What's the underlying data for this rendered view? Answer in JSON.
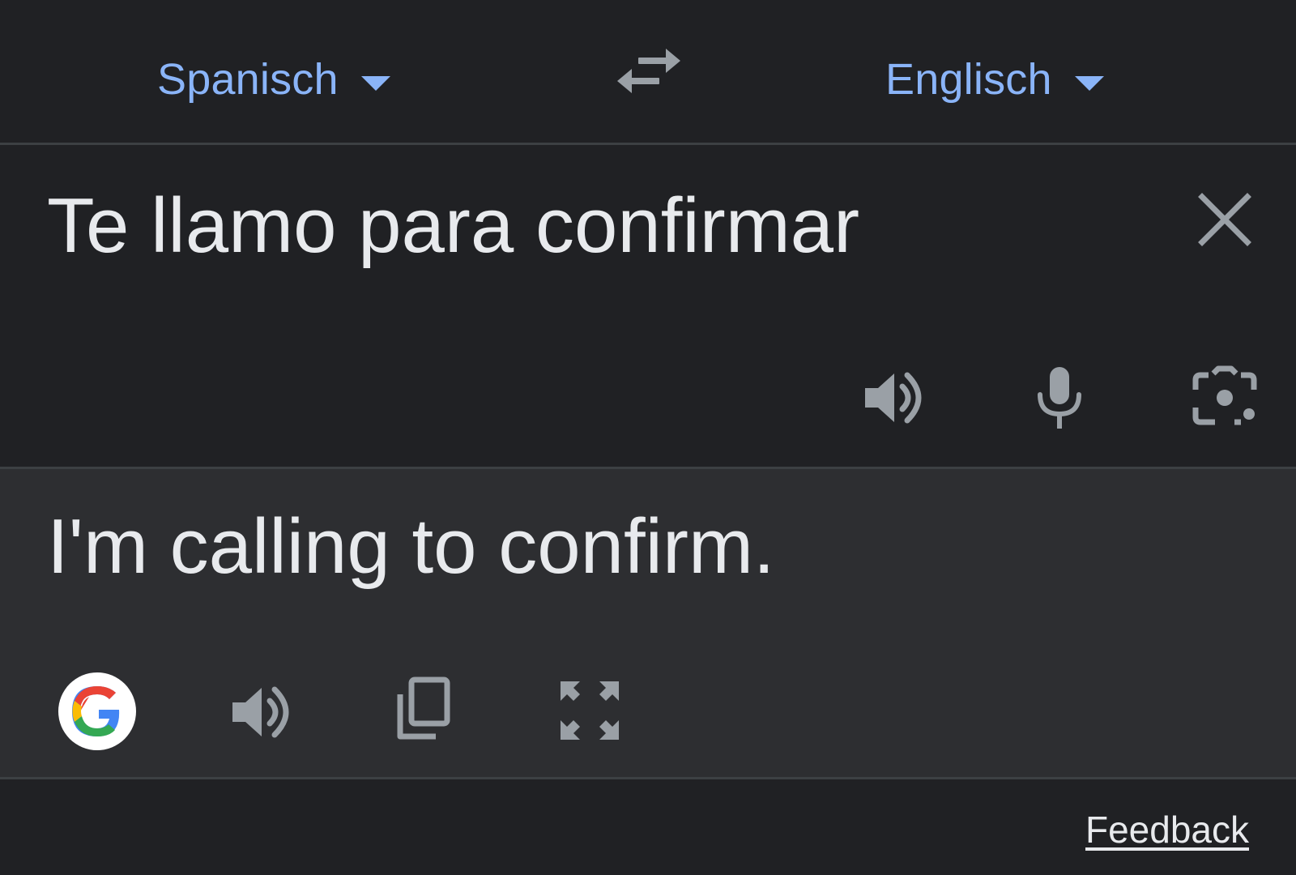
{
  "header": {
    "source_language": "Spanisch",
    "target_language": "Englisch",
    "swap_icon": "swap-arrows-icon",
    "dropdown_icon": "caret-down-icon"
  },
  "source": {
    "text": "Te llamo para confirmar",
    "actions": [
      "speaker-icon",
      "microphone-icon",
      "camera-lens-icon"
    ],
    "clear_icon": "close-icon"
  },
  "result": {
    "text": "I'm calling to confirm.",
    "actions": [
      "google-logo-icon",
      "speaker-icon",
      "copy-icon",
      "fullscreen-icon"
    ]
  },
  "footer": {
    "feedback_label": "Feedback"
  },
  "colors": {
    "background": "#202124",
    "result_background": "#2d2e31",
    "accent": "#8ab4f8",
    "text": "#e8eaed",
    "icon": "#9aa0a6",
    "divider": "#3c4043"
  }
}
